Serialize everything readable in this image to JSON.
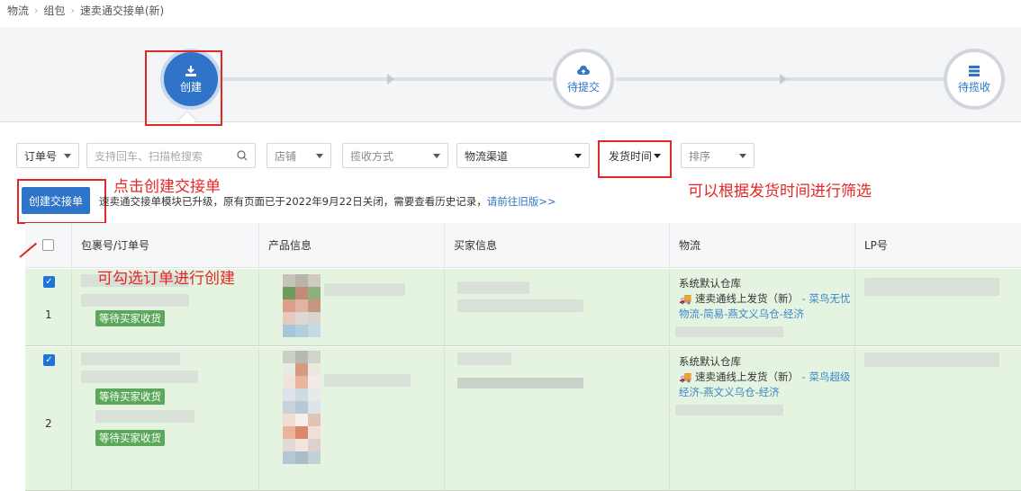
{
  "breadcrumb": [
    "物流",
    "组包",
    "速卖通交接单(新)"
  ],
  "steps": [
    {
      "label": "创建",
      "icon": "download-icon",
      "active": true
    },
    {
      "label": "待提交",
      "icon": "cloud-upload-icon",
      "active": false
    },
    {
      "label": "待揽收",
      "icon": "server-icon",
      "active": false
    }
  ],
  "filters": {
    "order_no": "订单号",
    "search_placeholder": "支持回车、扫描枪搜索",
    "store": "店铺",
    "pickup": "揽收方式",
    "channel": "物流渠道",
    "ship_time": "发货时间",
    "sort": "排序"
  },
  "actions": {
    "create": "创建交接单",
    "notice": "速卖通交接单模块已升级，原有页面已于2022年9月22日关闭，需要查看历史记录，",
    "notice_link": "请前往旧版>>"
  },
  "annotations": {
    "create_hint": "点击创建交接单",
    "filter_hint": "可以根据发货时间进行筛选",
    "select_hint": "可勾选订单进行创建"
  },
  "table": {
    "headers": [
      "包裹号/订单号",
      "产品信息",
      "买家信息",
      "物流",
      "LP号"
    ],
    "rows": [
      {
        "index": "1",
        "checked": true,
        "statuses": [
          "等待买家收货"
        ],
        "warehouse": "系统默认仓库",
        "ship_line": "🚚 速卖通线上发货（新）",
        "carrier_link": "- 菜鸟无忧物流-简易-燕文义乌仓-经济"
      },
      {
        "index": "2",
        "checked": true,
        "statuses": [
          "等待买家收货",
          "等待买家收货"
        ],
        "warehouse": "系统默认仓库",
        "ship_line": "🚚 速卖通线上发货（新）",
        "carrier_link": "- 菜鸟超级经济-燕文义乌仓-经济"
      }
    ]
  },
  "colors": {
    "primary": "#2f74c8",
    "annotation": "#e32626",
    "row_selected": "#e5f3e1",
    "status_badge": "#5ca85a"
  }
}
